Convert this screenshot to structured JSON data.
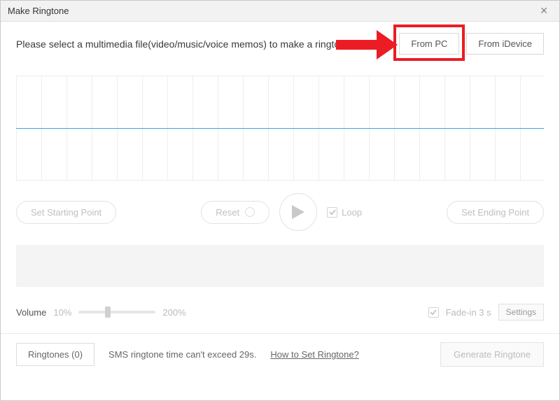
{
  "window": {
    "title": "Make Ringtone",
    "close_glyph": "✕"
  },
  "instruction": "Please select a multimedia file(video/music/voice memos) to make a ringtone",
  "source_buttons": {
    "from_pc": "From PC",
    "from_idevice": "From iDevice"
  },
  "controls": {
    "set_start": "Set Starting Point",
    "reset": "Reset",
    "loop": "Loop",
    "set_end": "Set Ending Point"
  },
  "volume": {
    "label": "Volume",
    "min_pct": "10%",
    "max_pct": "200%"
  },
  "fade": {
    "label": "Fade-in 3 s",
    "settings": "Settings"
  },
  "footer": {
    "ringtones_btn": "Ringtones (0)",
    "hint": "SMS ringtone time can't exceed 29s.",
    "how_to_link": "How to Set Ringtone?",
    "generate": "Generate Ringtone"
  }
}
